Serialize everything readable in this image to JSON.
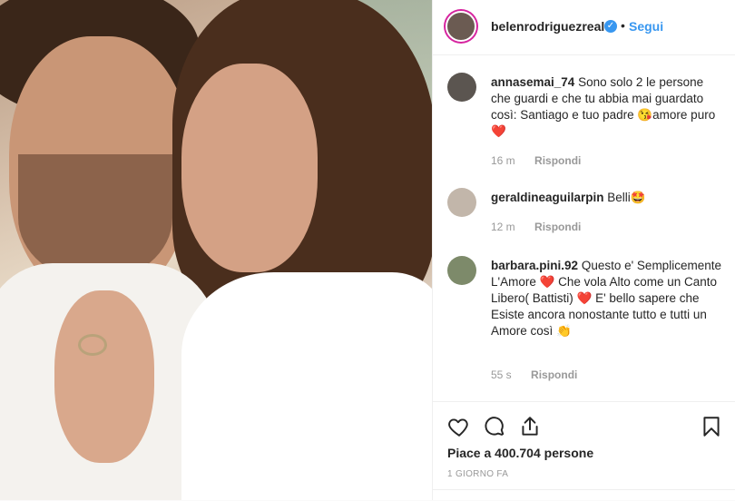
{
  "post": {
    "username": "belenrodriguezreal",
    "dot": "•",
    "follow_label": "Segui",
    "verified_glyph": "✓"
  },
  "comments": [
    {
      "username": "annasemai_74",
      "text": "Sono solo 2 le persone che guardi e che tu abbia mai guardato così: Santiago e tuo padre 😘amore puro❤️",
      "time": "16 m",
      "reply": "Rispondi"
    },
    {
      "username": "geraldineaguilarpin",
      "text": "Belli🤩",
      "time": "12 m",
      "reply": "Rispondi"
    },
    {
      "username": "barbara.pini.92",
      "text": "Questo e' Semplicemente L'Amore ❤️ Che vola Alto come un Canto Libero( Battisti) ❤️ E' bello sapere che Esiste ancora nonostante tutto e tutti un Amore così 👏",
      "time": "55 s",
      "reply": "Rispondi"
    }
  ],
  "footer": {
    "likes": "Piace a 400.704 persone",
    "date": "1 GIORNO FA"
  },
  "icons": [
    "heart-icon",
    "comment-icon",
    "share-icon",
    "bookmark-icon"
  ],
  "colors": {
    "accent": "#3897f0",
    "muted": "#999999"
  }
}
